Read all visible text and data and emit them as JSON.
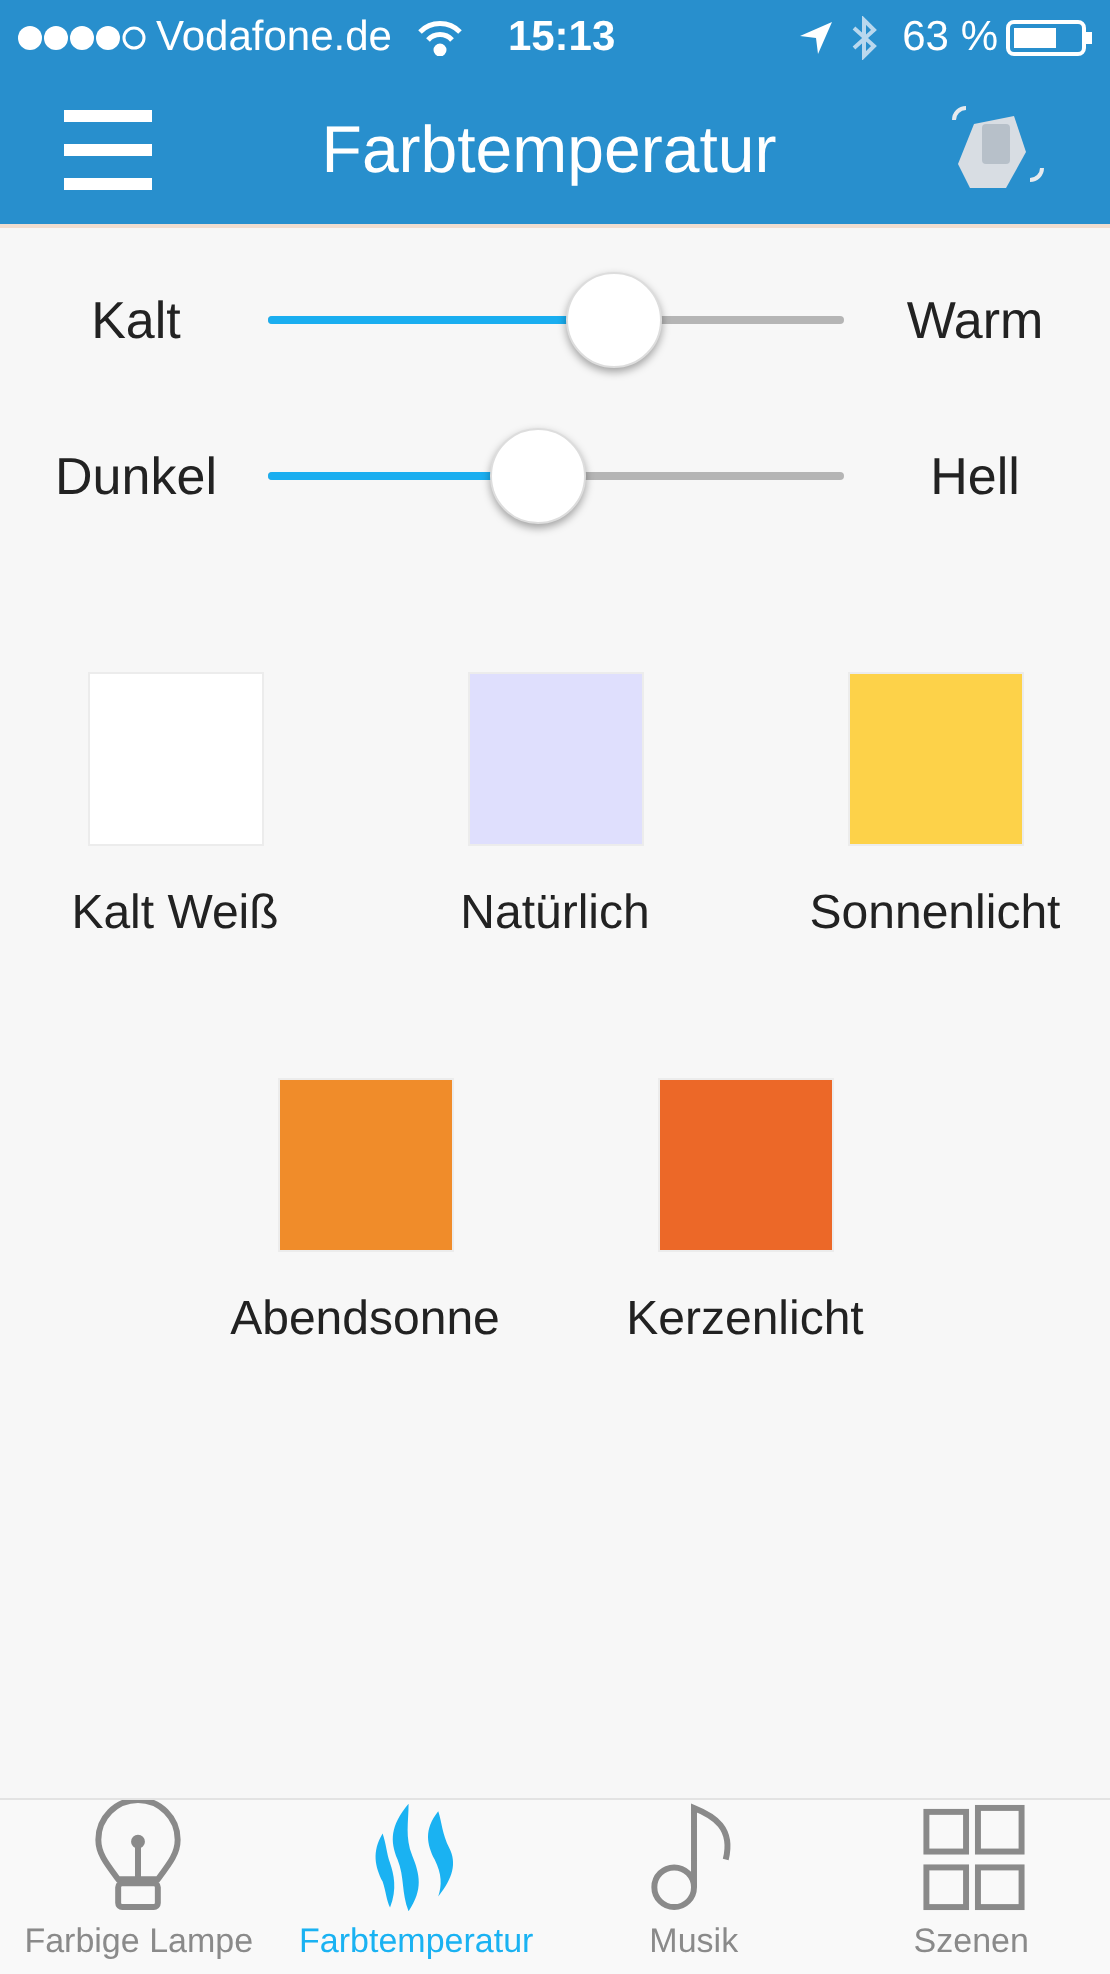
{
  "status_bar": {
    "carrier": "Vodafone.de",
    "time": "15:13",
    "battery": "63 %"
  },
  "nav_bar": {
    "title": "Farbtemperatur"
  },
  "sliders": [
    {
      "left_label": "Kalt",
      "right_label": "Warm",
      "level": 0.6
    },
    {
      "left_label": "Dunkel",
      "right_label": "Hell",
      "level": 0.47
    }
  ],
  "presets": [
    [
      {
        "label": "Kalt Weiß",
        "color": "#ffffff"
      },
      {
        "label": "Natürlich",
        "color": "#dfdffd"
      },
      {
        "label": "Sonnenlicht",
        "color": "#fdd249"
      }
    ],
    [
      {
        "label": "Abendsonne",
        "color": "#f08c2a"
      },
      {
        "label": "Kerzenlicht",
        "color": "#ec6828"
      }
    ]
  ],
  "tabs": [
    {
      "label": "Farbige Lampe",
      "kind": "bulb",
      "selected": false
    },
    {
      "label": "Farbtemperatur",
      "kind": "flame",
      "selected": true
    },
    {
      "label": "Musik",
      "kind": "note",
      "selected": false
    },
    {
      "label": "Szenen",
      "kind": "grid",
      "selected": false
    }
  ]
}
